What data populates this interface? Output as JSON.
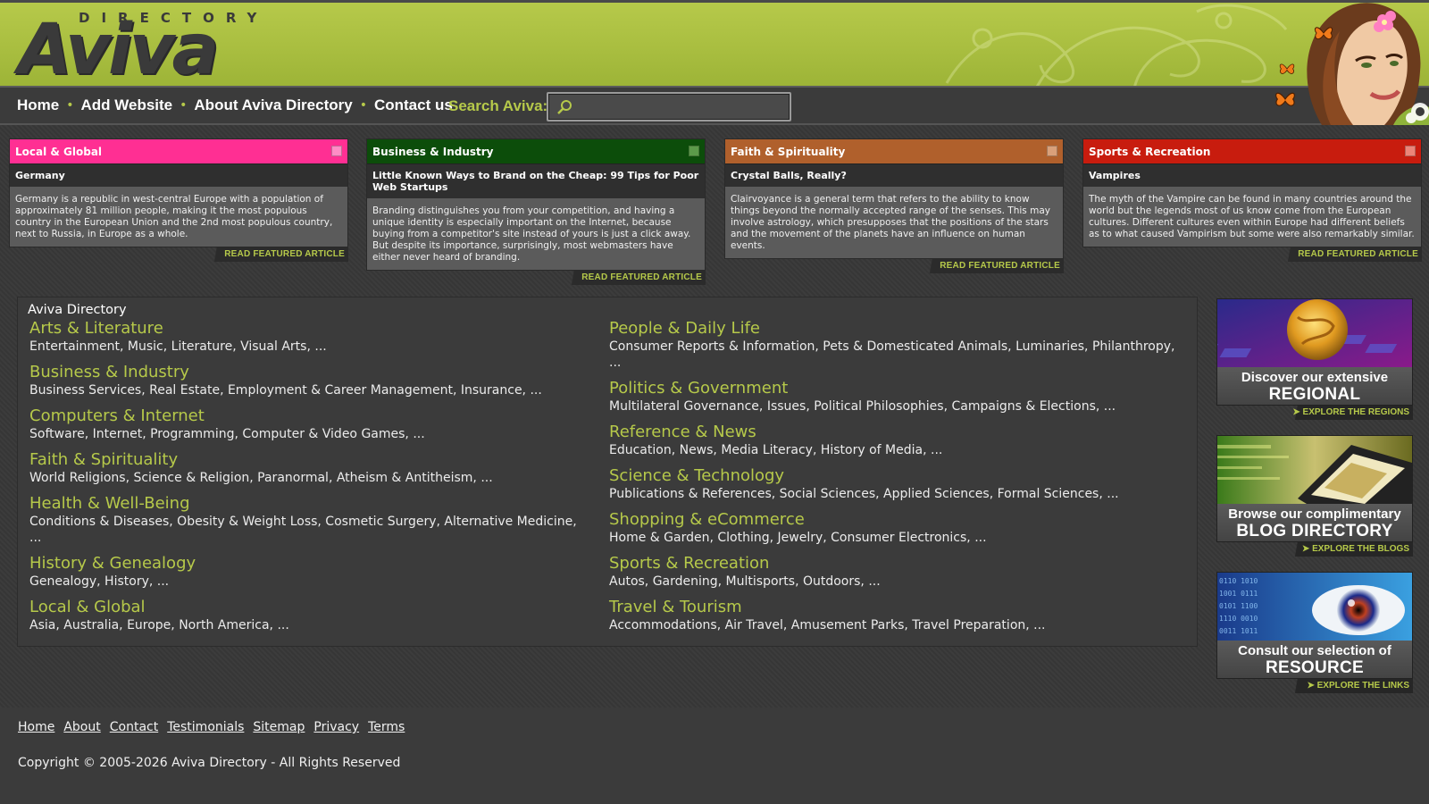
{
  "header": {
    "logo_top": "DIRECTORY",
    "logo_main": "Aviva"
  },
  "nav": {
    "items": [
      {
        "label": "Home"
      },
      {
        "label": "Add Website"
      },
      {
        "label": "About Aviva Directory"
      },
      {
        "label": "Contact us"
      }
    ],
    "search_label": "Search Aviva:",
    "search_value": ""
  },
  "featured": [
    {
      "category": "Local & Global",
      "color": "#ff2f93",
      "title": "Germany",
      "text": "Germany is a republic in west-central Europe with a population of approximately 81 million people, making it the most populous country in the European Union and the 2nd most populous country, next to Russia, in Europe as a whole.",
      "link": "READ FEATURED ARTICLE"
    },
    {
      "category": "Business & Industry",
      "color": "#0c4d0a",
      "title": "Little Known Ways to Brand on the Cheap: 99 Tips for Poor Web Startups",
      "text": "Branding distinguishes you from your competition, and having a unique identity is especially important on the Internet, because buying from a competitor's site instead of yours is just a click away. But despite its importance, surprisingly, most webmasters have either never heard of branding.",
      "link": "READ FEATURED ARTICLE"
    },
    {
      "category": "Faith & Spirituality",
      "color": "#b0602c",
      "title": "Crystal Balls, Really?",
      "text": "Clairvoyance is a general term that refers to the ability to know things beyond the normally accepted range of the senses. This may involve astrology, which presupposes that the positions of the stars and the movement of the planets have an influence on human events.",
      "link": "READ FEATURED ARTICLE"
    },
    {
      "category": "Sports & Recreation",
      "color": "#c81c0e",
      "title": "Vampires",
      "text": "The myth of the Vampire can be found in many countries around the world but the legends most of us know come from the European cultures. Different cultures even within Europe had different beliefs as to what caused Vampirism but some were also remarkably similar.",
      "link": "READ FEATURED ARTICLE"
    }
  ],
  "directory": {
    "title": "Aviva Directory",
    "left": [
      {
        "name": "Arts & Literature",
        "subs": "Entertainment, Music, Literature, Visual Arts, ..."
      },
      {
        "name": "Business & Industry",
        "subs": "Business Services, Real Estate, Employment & Career Management, Insurance, ..."
      },
      {
        "name": "Computers & Internet",
        "subs": "Software, Internet, Programming, Computer & Video Games, ..."
      },
      {
        "name": "Faith & Spirituality",
        "subs": "World Religions, Science & Religion, Paranormal, Atheism & Antitheism, ..."
      },
      {
        "name": "Health & Well-Being",
        "subs": "Conditions & Diseases, Obesity & Weight Loss, Cosmetic Surgery, Alternative Medicine, ..."
      },
      {
        "name": "History & Genealogy",
        "subs": "Genealogy, History, ..."
      },
      {
        "name": "Local & Global",
        "subs": "Asia, Australia, Europe, North America, ..."
      }
    ],
    "right": [
      {
        "name": "People & Daily Life",
        "subs": "Consumer Reports & Information, Pets & Domesticated Animals, Luminaries, Philanthropy, ..."
      },
      {
        "name": "Politics & Government",
        "subs": "Multilateral Governance, Issues, Political Philosophies, Campaigns & Elections, ..."
      },
      {
        "name": "Reference & News",
        "subs": "Education, News, Media Literacy, History of Media, ..."
      },
      {
        "name": "Science & Technology",
        "subs": "Publications & References, Social Sciences, Applied Sciences, Formal Sciences, ..."
      },
      {
        "name": "Shopping & eCommerce",
        "subs": "Home & Garden, Clothing, Jewelry, Consumer Electronics, ..."
      },
      {
        "name": "Sports & Recreation",
        "subs": "Autos, Gardening, Multisports, Outdoors, ..."
      },
      {
        "name": "Travel & Tourism",
        "subs": "Accommodations, Air Travel, Amusement Parks, Travel Preparation, ..."
      }
    ]
  },
  "promos": [
    {
      "line1": "Discover our extensive",
      "line2": "REGIONAL DIRECTORY",
      "link": "EXPLORE THE REGIONS",
      "icon": "globe-keyboard-image"
    },
    {
      "line1": "Browse our complimentary",
      "line2": "BLOG DIRECTORY",
      "link": "EXPLORE THE BLOGS",
      "icon": "laptop-image"
    },
    {
      "line1": "Consult our selection of",
      "line2": "RESOURCE READINGS",
      "link": "EXPLORE THE LINKS",
      "icon": "eye-binary-image"
    }
  ],
  "footer": {
    "links": [
      {
        "label": "Home"
      },
      {
        "label": "About"
      },
      {
        "label": "Contact"
      },
      {
        "label": "Testimonials"
      },
      {
        "label": "Sitemap"
      },
      {
        "label": "Privacy"
      },
      {
        "label": "Terms"
      }
    ],
    "copyright": "Copyright © 2005-2026 Aviva Directory - All Rights Reserved"
  },
  "colors": {
    "accent": "#b6c94a",
    "background": "#3a3a3a"
  }
}
